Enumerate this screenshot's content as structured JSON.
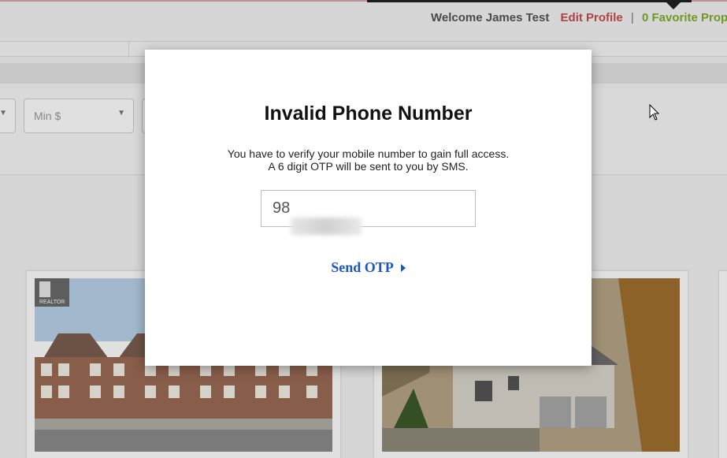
{
  "header": {
    "welcome": "Welcome James Test",
    "edit_profile": "Edit Profile",
    "separator": "|",
    "favorites": "0 Favorite Prop"
  },
  "filters": {
    "min_price_placeholder": "Min $"
  },
  "listings": [
    {
      "badge": "REALTOR"
    },
    {}
  ],
  "modal": {
    "title": "Invalid Phone Number",
    "message_line1": "You have to verify your mobile number to gain full access.",
    "message_line2": "A 6 digit OTP will be sent to you by SMS.",
    "phone_value": "98",
    "send_label": "Send OTP"
  },
  "colors": {
    "edit_profile": "#c94b4b",
    "favorites": "#7fae2a",
    "link": "#1a56c8"
  }
}
